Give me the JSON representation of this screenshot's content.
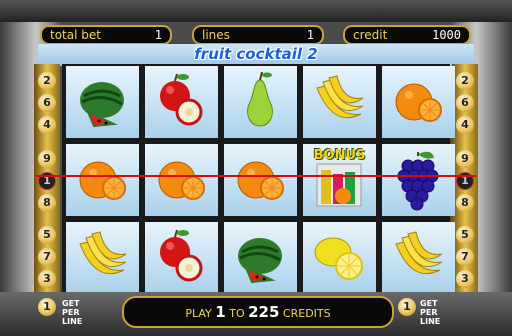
{
  "header": {
    "total_bet": {
      "label": "total bet",
      "value": "1"
    },
    "lines": {
      "label": "lines",
      "value": "1"
    },
    "credit": {
      "label": "credit",
      "value": "1000"
    }
  },
  "title": "fruit cocktail 2",
  "left_line_numbers": [
    "2",
    "6",
    "4",
    "9",
    "1",
    "8",
    "5",
    "7",
    "3"
  ],
  "right_line_numbers": [
    "2",
    "6",
    "4",
    "9",
    "1",
    "8",
    "5",
    "7",
    "3"
  ],
  "active_line": "1",
  "reels": [
    [
      "watermelon",
      "apple",
      "pear",
      "banana",
      "orange"
    ],
    [
      "orange",
      "orange",
      "orange",
      "bonus",
      "grapes"
    ],
    [
      "banana",
      "apple",
      "watermelon",
      "lemon",
      "banana"
    ]
  ],
  "bonus_label": "BONUS",
  "footer": {
    "bet_line_value": "1",
    "get_per_line": "GET PER LINE",
    "play_text_1": "PLAY",
    "play_num_1": "1",
    "play_text_2": "TO",
    "play_num_2": "225",
    "play_text_3": "CREDITS",
    "lines_value": "1"
  }
}
